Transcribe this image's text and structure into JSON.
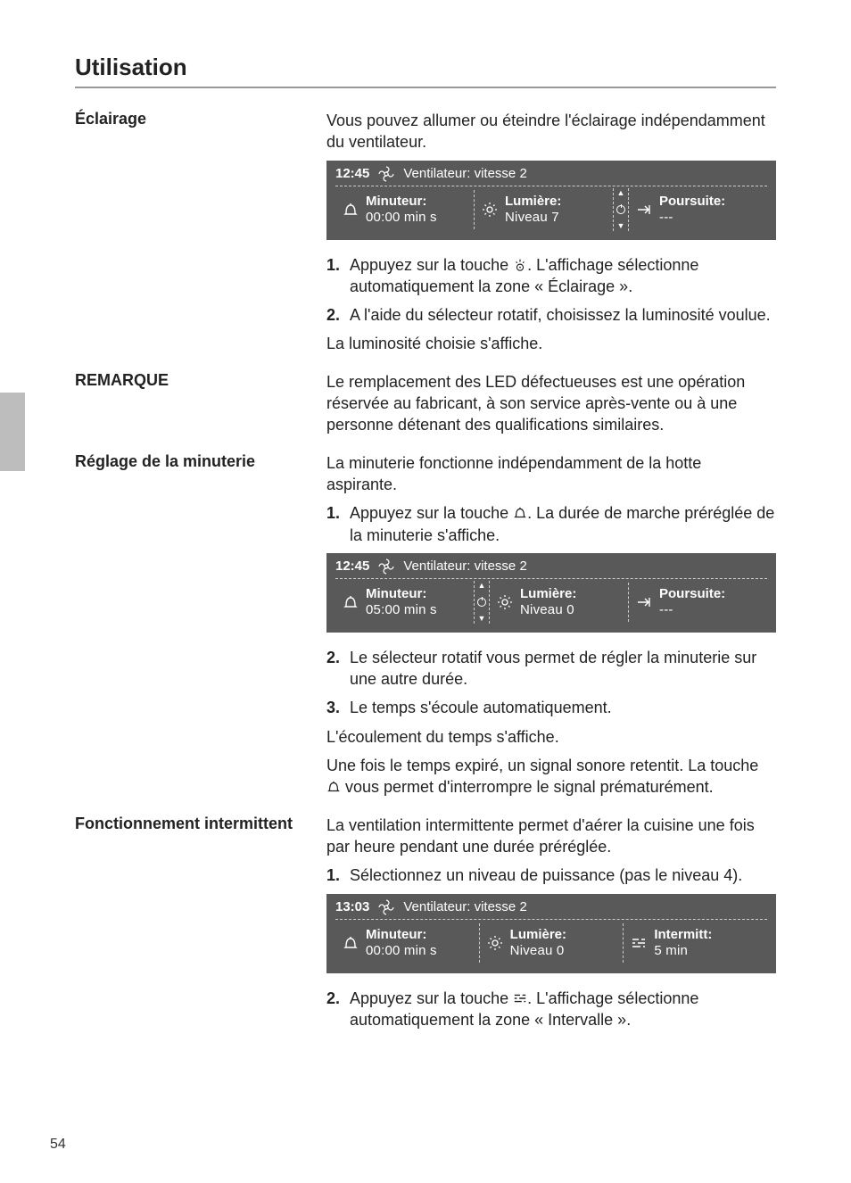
{
  "page": {
    "title": "Utilisation",
    "number": "54"
  },
  "s1": {
    "label": "Éclairage",
    "intro": "Vous pouvez allumer ou éteindre l'éclairage indépendamment du ventilateur.",
    "panel": {
      "time": "12:45",
      "fan": "Ventilateur: vitesse 2",
      "timer_label": "Minuteur:",
      "timer_value": "00:00 min s",
      "light_label": "Lumière:",
      "light_value": "Niveau 7",
      "follow_label": "Poursuite:",
      "follow_value": "---"
    },
    "step1a": "Appuyez sur la touche ",
    "step1b": ". L'affichage sélectionne automatiquement la zone « Éclairage ».",
    "step2": "A l'aide du sélecteur rotatif, choisissez la luminosité voulue.",
    "after": "La luminosité choisie s'affiche."
  },
  "s2": {
    "label": "REMARQUE",
    "text": "Le remplacement des LED défectueuses est une opération réservée au fabricant, à son service après-vente ou à une personne détenant des qualifications similaires."
  },
  "s3": {
    "label": "Réglage de la minuterie",
    "intro": "La minuterie fonctionne indépendamment de la hotte aspirante.",
    "step1a": "Appuyez sur la touche ",
    "step1b": ". La durée de marche préréglée de la minuterie s'affiche.",
    "panel": {
      "time": "12:45",
      "fan": "Ventilateur: vitesse 2",
      "timer_label": "Minuteur:",
      "timer_value": "05:00 min s",
      "light_label": "Lumière:",
      "light_value": "Niveau 0",
      "follow_label": "Poursuite:",
      "follow_value": "---"
    },
    "step2": "Le sélecteur rotatif vous permet de régler la minuterie sur une autre durée.",
    "step3": "Le temps s'écoule automatiquement.",
    "after1": "L'écoulement du temps s'affiche.",
    "after2a": "Une fois le temps expiré, un signal sonore retentit. La touche ",
    "after2b": " vous permet d'interrompre le signal prématurément."
  },
  "s4": {
    "label": "Fonctionnement intermittent",
    "intro": "La ventilation intermittente permet d'aérer la cuisine une fois par heure pendant une durée préréglée.",
    "step1": "Sélectionnez un niveau de puissance (pas le niveau 4).",
    "panel": {
      "time": "13:03",
      "fan": "Ventilateur: vitesse 2",
      "timer_label": "Minuteur:",
      "timer_value": "00:00 min s",
      "light_label": "Lumière:",
      "light_value": "Niveau 0",
      "interm_label": "Intermitt:",
      "interm_value": "5  min"
    },
    "step2a": "Appuyez sur la touche ",
    "step2b": ". L'affichage sélectionne automatiquement la zone « Intervalle »."
  }
}
